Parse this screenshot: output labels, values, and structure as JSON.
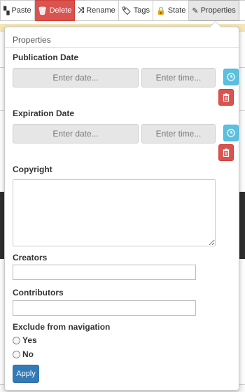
{
  "toolbar": {
    "paste_label": "Paste",
    "delete_label": "Delete",
    "rename_label": "Rename",
    "tags_label": "Tags",
    "state_label": "State",
    "properties_label": "Properties"
  },
  "popover": {
    "title": "Properties",
    "publication": {
      "label": "Publication Date",
      "date_placeholder": "Enter date...",
      "time_placeholder": "Enter time..."
    },
    "expiration": {
      "label": "Expiration Date",
      "date_placeholder": "Enter date...",
      "time_placeholder": "Enter time..."
    },
    "copyright": {
      "label": "Copyright",
      "value": ""
    },
    "creators": {
      "label": "Creators",
      "value": ""
    },
    "contributors": {
      "label": "Contributors",
      "value": ""
    },
    "exclude_nav": {
      "label": "Exclude from navigation",
      "options": [
        "Yes",
        "No"
      ]
    },
    "apply_label": "Apply"
  },
  "colors": {
    "delete_red": "#d9534f",
    "info_blue": "#5bc0de",
    "primary_blue": "#337ab7"
  }
}
